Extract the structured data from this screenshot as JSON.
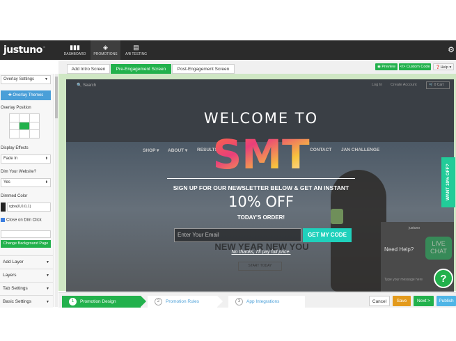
{
  "app": {
    "logo": "justuno",
    "logo_tm": "™"
  },
  "topnav": {
    "tabs": [
      {
        "label": "DASHBOARD",
        "icon": "bar-chart-icon"
      },
      {
        "label": "PROMOTIONS",
        "icon": "tag-icon"
      },
      {
        "label": "A/B TESTING",
        "icon": "clipboard-icon"
      }
    ],
    "active_tab": "PROMOTIONS",
    "settings_icon": "gear-icon"
  },
  "editor_tabs": [
    "Add Intro Screen",
    "Pre-Engagement Screen",
    "Post-Engagement Screen"
  ],
  "editor_active_tab": "Pre-Engagement Screen",
  "toolbar": {
    "preview": "◉ Preview",
    "custom_code": "</> Custom Code",
    "help": "❓Help ▾"
  },
  "sidebar": {
    "overlay_settings": "Overlay Settings",
    "overlay_themes": "✚ Overlay Themes",
    "overlay_position_label": "Overlay Position",
    "position_selected": "middle-center",
    "display_effects_label": "Display Effects",
    "display_effects_value": "Fade In",
    "dim_label": "Dim Your Website?",
    "dim_value": "Yes",
    "dimmed_color_label": "Dimmed Color",
    "dimmed_color_value": "rgba(0,0,0,1)",
    "close_on_dim_label": "Close on Dim Click",
    "close_on_dim_checked": true,
    "change_bg_button": "Change Background Page",
    "sections": [
      "Add Layer",
      "Layers",
      "Tab Settings",
      "Basic Settings"
    ]
  },
  "site": {
    "search": "🔍 Search",
    "login": "Log In",
    "create_account": "Create Account",
    "cart": "🛒 0 Cart",
    "nav": [
      "SHOP ▾",
      "ABOUT ▾",
      "RESULTS",
      "CONTACT",
      "JAN CHALLENGE"
    ],
    "hero_text": "NEW YEAR NEW YOU",
    "hero_button": "START TODAY"
  },
  "popup": {
    "welcome": "WELCOME TO",
    "brand_logo": "SMT",
    "signup": "SIGN UP FOR OUR NEWSLETTER BELOW & GET AN INSTANT",
    "offer": "10% OFF",
    "today": "TODAY'S ORDER!",
    "email_placeholder": "Enter Your Email",
    "cta": "GET MY CODE",
    "decline": "No thanks, I'll pay full price."
  },
  "chat": {
    "brand": "justuno",
    "need_help": "Need Help?",
    "live_chat": "LIVE CHAT",
    "message_placeholder": "Type your message here"
  },
  "side_tab": "WANT 10% OFF?",
  "help_fab": "?",
  "steps": [
    {
      "num": "1",
      "label": "Promotion Design"
    },
    {
      "num": "2",
      "label": "Promotion Rules"
    },
    {
      "num": "3",
      "label": "App Integrations"
    }
  ],
  "step_active": "Promotion Design",
  "footer_buttons": {
    "cancel": "Cancel",
    "save": "Save",
    "next": "Next >",
    "publish": "Publish"
  },
  "colors": {
    "brand_green": "#22b14c",
    "brand_blue": "#4a9fd8",
    "teal_cta": "#1fd1bc",
    "save_orange": "#e39a1c",
    "nav_dark": "#2b2b2b"
  }
}
